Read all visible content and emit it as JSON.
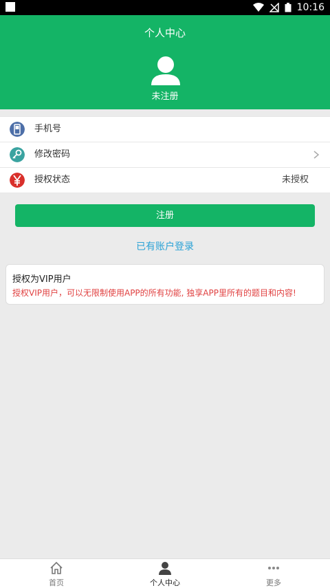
{
  "status_bar": {
    "time": "10:16"
  },
  "header": {
    "title": "个人中心",
    "user_status": "未注册"
  },
  "list": [
    {
      "label": "手机号",
      "value": "",
      "icon": "phone-icon",
      "color": "#4d6fa8"
    },
    {
      "label": "修改密码",
      "value": "",
      "icon": "key-icon",
      "color": "#3aa3a0"
    },
    {
      "label": "授权状态",
      "value": "未授权",
      "icon": "yen-icon",
      "color": "#d9302b"
    }
  ],
  "register_button": {
    "label": "注册"
  },
  "login_link": {
    "label": "已有账户登录"
  },
  "vip_card": {
    "title": "授权为VIP用户",
    "description": "授权VIP用户，可以无限制使用APP的所有功能, 独享APP里所有的题目和内容!"
  },
  "tabbar": {
    "items": [
      {
        "label": "首页",
        "icon": "home-icon"
      },
      {
        "label": "个人中心",
        "icon": "person-icon",
        "active": true
      },
      {
        "label": "更多",
        "icon": "more-icon"
      }
    ]
  },
  "colors": {
    "primary": "#14b466",
    "link": "#2aa2d6",
    "warning_text": "#e04040"
  }
}
